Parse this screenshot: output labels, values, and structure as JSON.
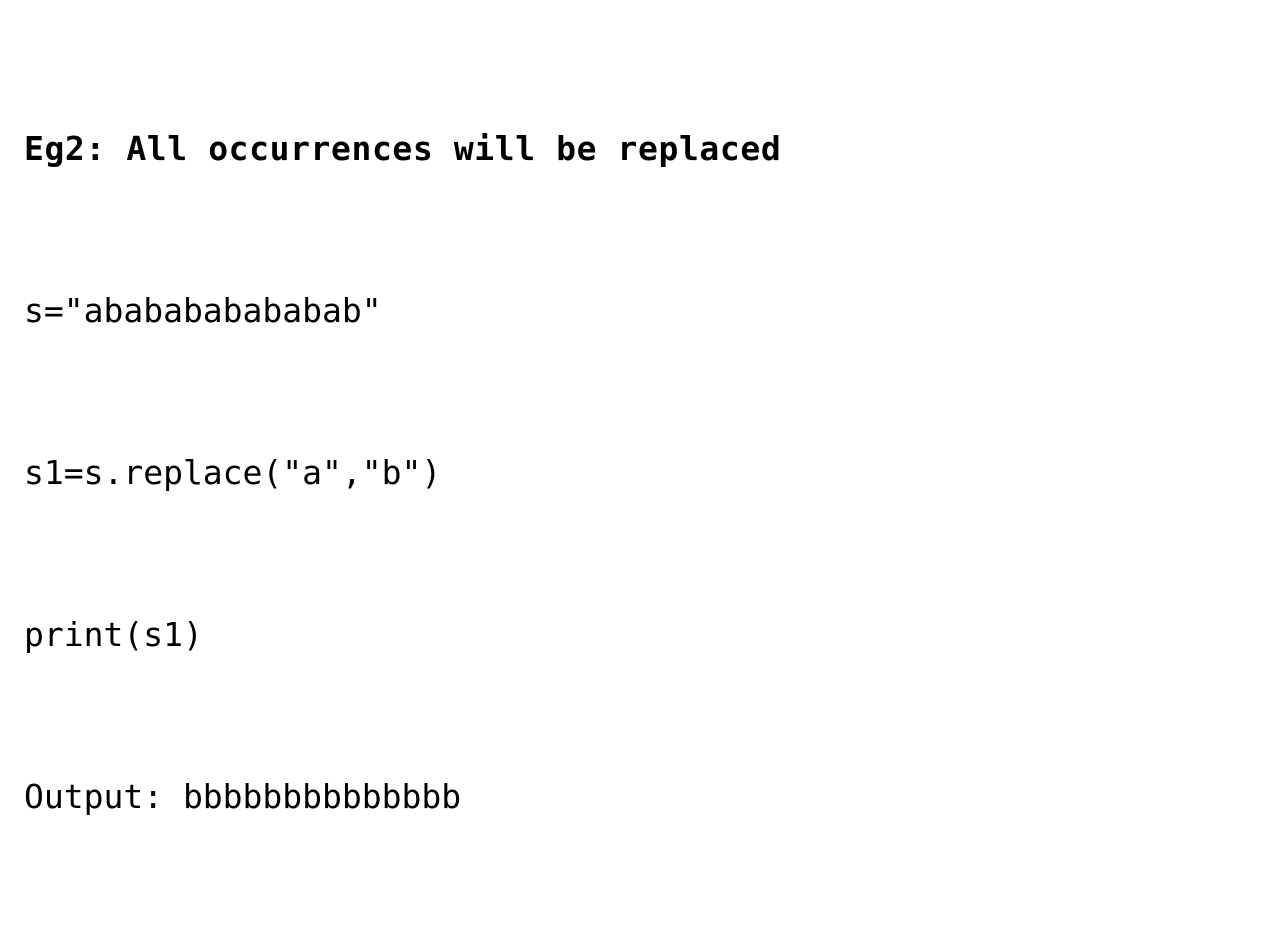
{
  "slide": {
    "heading": "Eg2: All occurrences will be replaced",
    "lines": [
      "s=\"ababababababab\"",
      "s1=s.replace(\"a\",\"b\")",
      "print(s1)",
      "Output: bbbbbbbbbbbbbb"
    ]
  }
}
